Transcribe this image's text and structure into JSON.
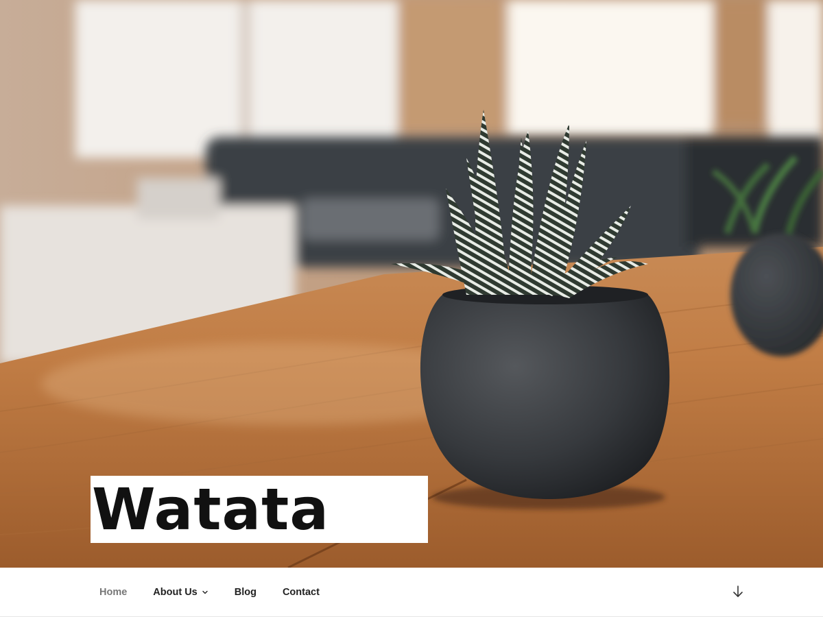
{
  "site": {
    "title": "Watata"
  },
  "nav": {
    "items": [
      {
        "label": "Home",
        "current": true
      },
      {
        "label": "About Us",
        "has_submenu": true
      },
      {
        "label": "Blog"
      },
      {
        "label": "Contact"
      }
    ]
  },
  "icons": {
    "submenu": "chevron-down-icon",
    "scroll": "arrow-down-icon"
  },
  "colors": {
    "nav_text": "#222222",
    "nav_current": "#767676",
    "title_text": "#111111"
  }
}
